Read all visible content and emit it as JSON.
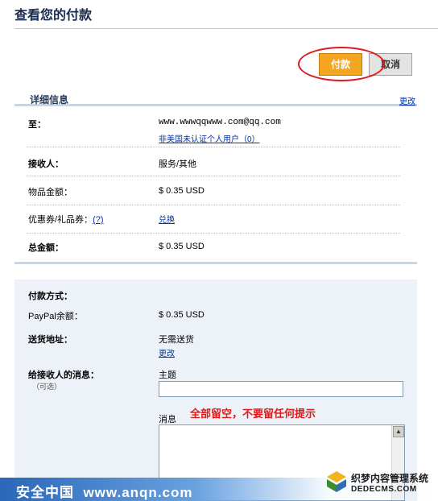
{
  "page_title": "查看您的付款",
  "buttons": {
    "pay": "付款",
    "cancel": "取消"
  },
  "details": {
    "section_title": "详细信息",
    "change_link": "更改",
    "to": {
      "label": "至：",
      "email": "www.wwwqqwww.com@qq.com",
      "status_link": "非美国未认证个人用户（0）"
    },
    "recipient": {
      "label": "接收人：",
      "value": "服务/其他"
    },
    "item_amount": {
      "label": "物品金额：",
      "value": "$ 0.35 USD"
    },
    "coupon": {
      "label": "优惠券/礼品券：",
      "help": "(?)",
      "redeem_link": "兑换"
    },
    "total": {
      "label": "总金额：",
      "value": "$ 0.35 USD"
    }
  },
  "payment": {
    "method_label": "付款方式：",
    "balance": {
      "label": "PayPal余额：",
      "value": "$ 0.35 USD"
    },
    "shipping": {
      "label": "送货地址：",
      "value": "无需送货",
      "change_link": "更改"
    },
    "message": {
      "label": "给接收人的消息：",
      "optional": "（可选）",
      "subject_label": "主题",
      "body_label": "消息"
    }
  },
  "annotation": "全部留空，不要留任何提示",
  "watermark": {
    "left": "安全中国  www.anqn.com",
    "right_line1": "织梦内容管理系统",
    "right_line2": "DEDECMS.COM"
  },
  "colors": {
    "accent_button": "#f5a621",
    "annotation_red": "#e01919",
    "link_blue": "#0033aa",
    "panel_bg": "#edf2f8"
  }
}
